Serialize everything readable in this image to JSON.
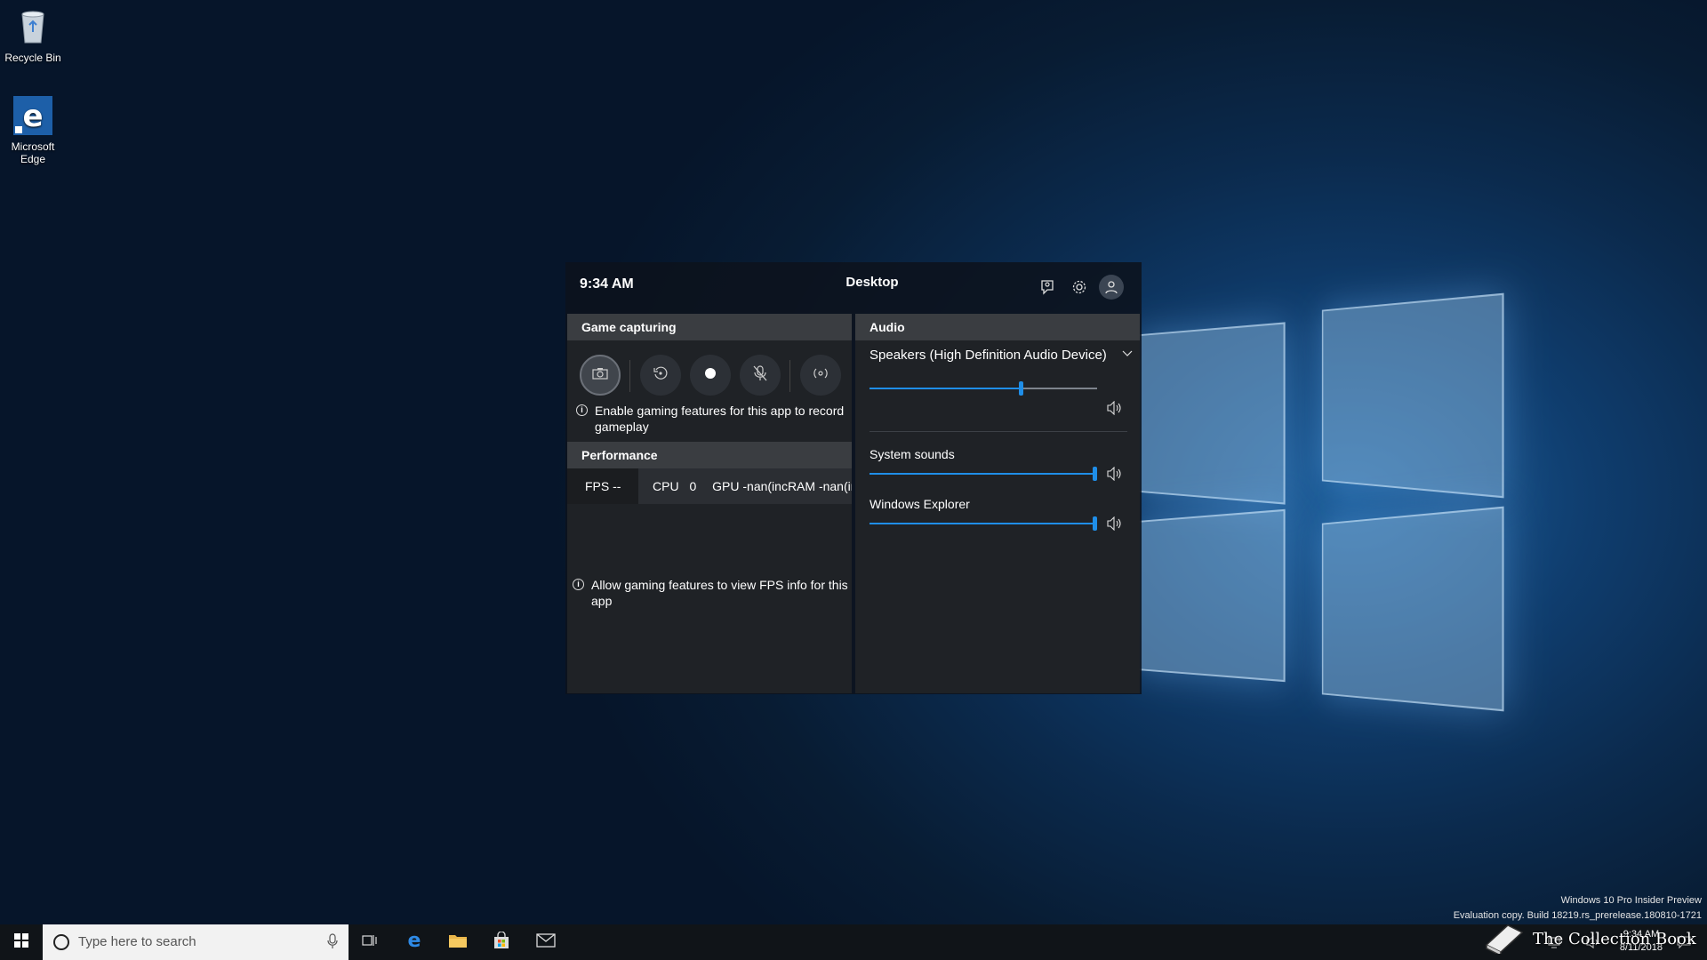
{
  "desktop": {
    "icons": [
      {
        "label": "Recycle Bin"
      },
      {
        "label": "Microsoft Edge"
      }
    ]
  },
  "gamebar": {
    "time": "9:34 AM",
    "title": "Desktop",
    "header_icons": [
      "looking-for-group-icon",
      "settings-gear-icon",
      "profile-icon"
    ],
    "capture": {
      "heading": "Game capturing",
      "buttons": [
        "camera-icon",
        "replay-icon",
        "record-icon",
        "mic-off-icon",
        "broadcast-icon"
      ],
      "notice": "Enable gaming features for this app to record gameplay"
    },
    "performance": {
      "heading": "Performance",
      "fps": "FPS --",
      "cpu_label": "CPU",
      "cpu_value": "0",
      "gpu_text": "GPU -nan(incRAM -nan(inc",
      "notice": "Allow gaming features to view FPS info for this app"
    },
    "audio": {
      "heading": "Audio",
      "device": "Speakers (High Definition Audio Device)",
      "master_volume": 0.67,
      "apps": [
        {
          "name": "System sounds",
          "volume": 1.0
        },
        {
          "name": "Windows Explorer",
          "volume": 1.0
        }
      ]
    }
  },
  "taskbar": {
    "search_placeholder": "Type here to search",
    "apps": [
      "task-view-icon",
      "edge-icon",
      "file-explorer-icon",
      "store-icon",
      "mail-icon"
    ],
    "date": "8/11/2018"
  },
  "watermark": {
    "line1": "Windows 10 Pro Insider Preview",
    "line2": "Evaluation copy. Build 18219.rs_prerelease.180810-1721"
  },
  "overlay": {
    "brand": "The Collection Book"
  },
  "colors": {
    "accent": "#1f8ee8",
    "panel": "#1f2226",
    "panel_head": "#3a3d41"
  }
}
